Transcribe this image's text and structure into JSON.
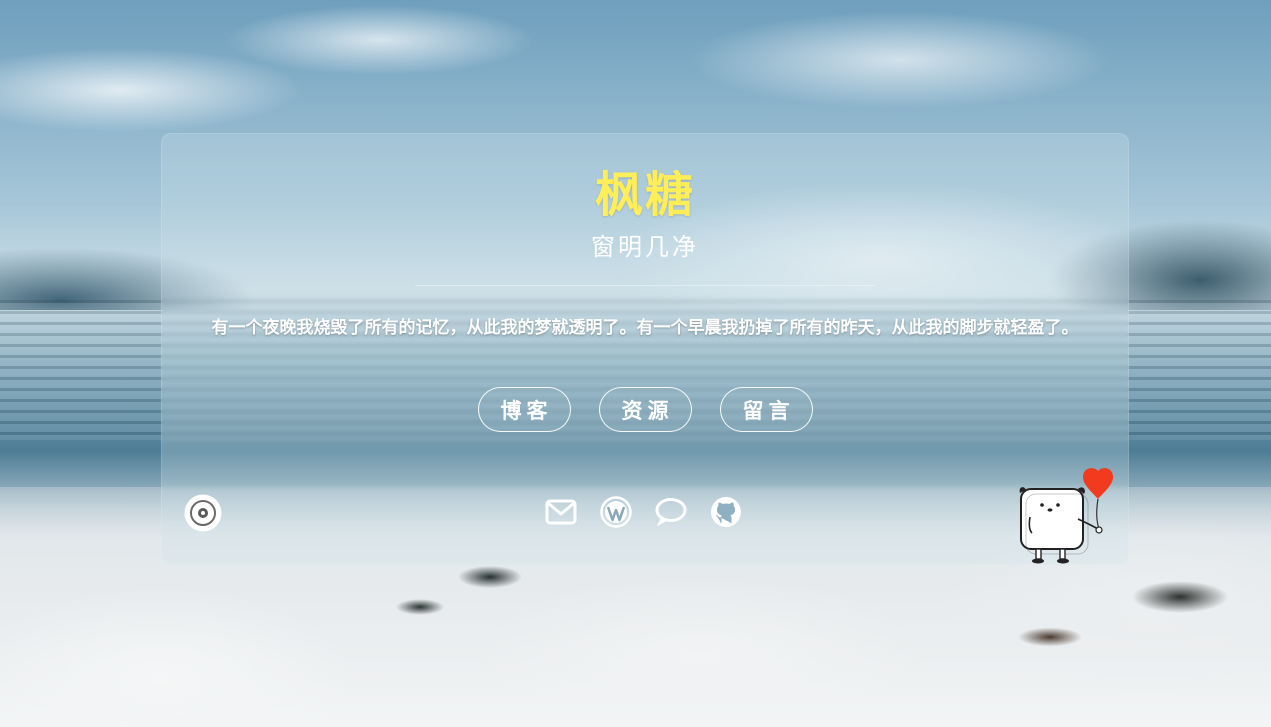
{
  "header": {
    "title": "枫糖",
    "subtitle": "窗明几净"
  },
  "motto": "有一个夜晚我烧毁了所有的记忆，从此我的梦就透明了。有一个早晨我扔掉了所有的昨天，从此我的脚步就轻盈了。",
  "nav": {
    "items": [
      {
        "label": "博客"
      },
      {
        "label": "资源"
      },
      {
        "label": "留言"
      }
    ]
  },
  "icons": {
    "music": "vinyl-disc-icon",
    "social": [
      "mail-icon",
      "wordpress-icon",
      "chat-bubble-icon",
      "github-icon"
    ],
    "mascot": "bear-with-heart-balloon"
  },
  "colors": {
    "title": "#ffee58",
    "text": "#ffffff",
    "heart": "#f23a1f"
  }
}
